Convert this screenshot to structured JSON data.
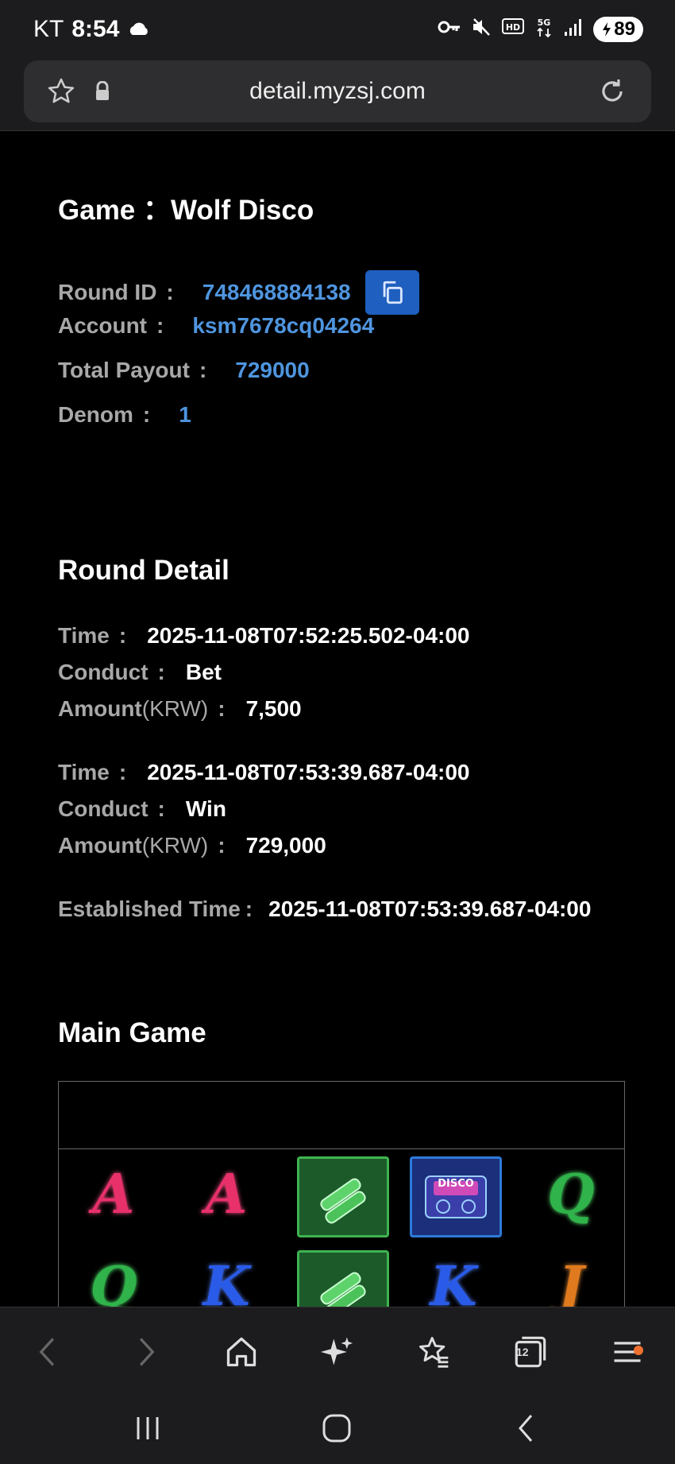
{
  "status_bar": {
    "carrier": "KT",
    "time": "8:54",
    "battery": "89"
  },
  "browser": {
    "url": "detail.myzsj.com",
    "tab_count": "12"
  },
  "game": {
    "title": "Game ：Wolf Disco",
    "round_id_label": "Round ID",
    "round_id": "748468884138",
    "account_label": "Account",
    "account": "ksm7678cq04264",
    "total_payout_label": "Total Payout",
    "total_payout": "729000",
    "denom_label": "Denom",
    "denom": "1"
  },
  "round_detail": {
    "title": "Round Detail",
    "time_label": "Time",
    "conduct_label": "Conduct",
    "amount_label": "Amount",
    "amount_unit": "(KRW)",
    "entries": [
      {
        "time": "2025-11-08T07:52:25.502-04:00",
        "conduct": "Bet",
        "amount": "7,500"
      },
      {
        "time": "2025-11-08T07:53:39.687-04:00",
        "conduct": "Win",
        "amount": "729,000"
      }
    ],
    "established_label": "Established Time",
    "established_time": "2025-11-08T07:53:39.687-04:00"
  },
  "main_game": {
    "title": "Main Game",
    "reel_rows": [
      [
        "A",
        "A",
        "bottles",
        "disco",
        "Q"
      ],
      [
        "Q",
        "K",
        "bottles",
        "K",
        "J"
      ]
    ],
    "disco_label": "DISCO"
  },
  "colors": {
    "accent_blue": "#4f95df",
    "copy_button": "#1f5fbf",
    "label_gray": "#a8a8a8"
  },
  "icons": {
    "copy": "copy-icon",
    "back": "back-arrow-icon",
    "forward": "forward-arrow-icon",
    "home": "home-icon",
    "ai": "sparkle-icon",
    "bookmarks": "bookmark-star-icon",
    "tabs": "tabs-icon",
    "menu": "menu-icon"
  }
}
